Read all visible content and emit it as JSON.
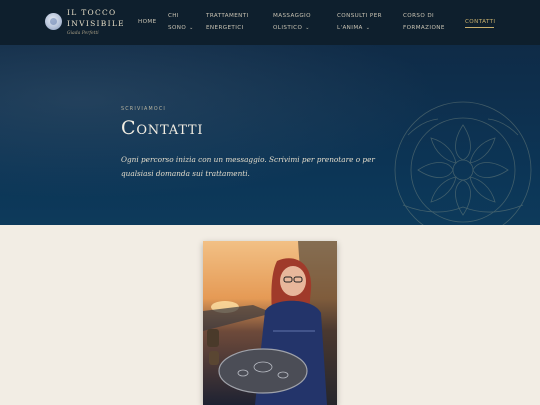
{
  "header": {
    "brand_line1": "IL TOCCO",
    "brand_line2": "INVISIBILE",
    "brand_sub": "Giada Perfetti",
    "nav": [
      {
        "line1": "HOME",
        "line2": ""
      },
      {
        "line1": "CHI",
        "line2": "SONO"
      },
      {
        "line1": "TRATTAMENTI",
        "line2": "ENERGETICI"
      },
      {
        "line1": "MASSAGGIO",
        "line2": "OLISTICO"
      },
      {
        "line1": "CONSULTI PER",
        "line2": "L'ANIMA"
      },
      {
        "line1": "CORSO DI",
        "line2": "FORMAZIONE"
      },
      {
        "line1": "CONTATTI",
        "line2": ""
      }
    ],
    "caret_glyph": "⌄",
    "active_color": "#c9b06d"
  },
  "hero": {
    "eyebrow": "SCRIVIAMOCI",
    "title": "Contatti",
    "description": "Ogni percorso inizia con un messaggio. Scrivimi per prenotare o per qualsiasi domanda sui trattamenti."
  },
  "colors": {
    "header_bg": "#0e1f2d",
    "hero_bg": "#0c3556",
    "page_bg": "#f2ede4",
    "accent": "#c9b06d"
  }
}
